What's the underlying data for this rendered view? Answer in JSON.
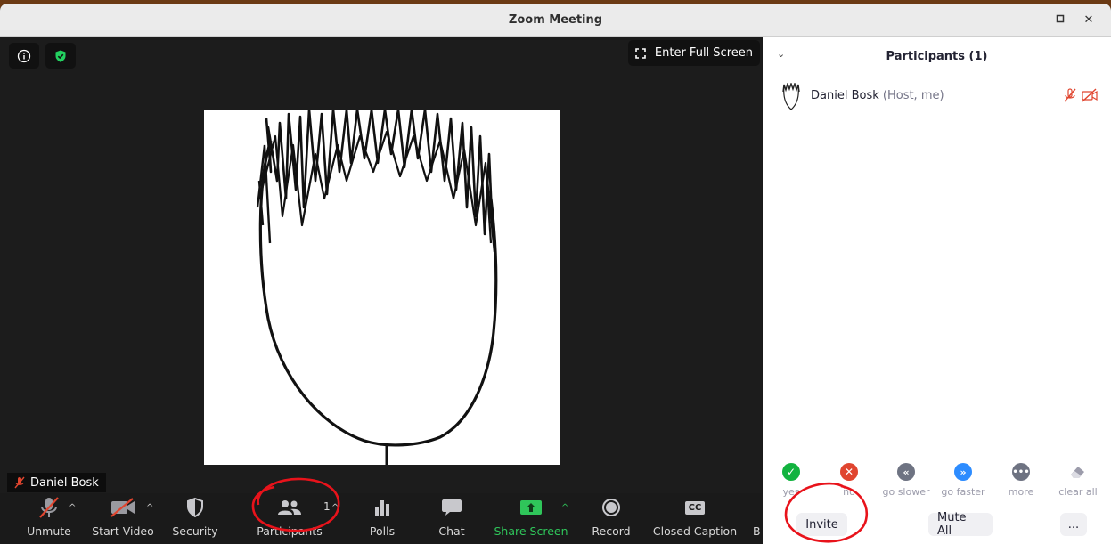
{
  "window": {
    "title": "Zoom Meeting"
  },
  "video": {
    "fullscreen_label": "Enter Full Screen",
    "name_label": "Daniel Bosk"
  },
  "toolbar": {
    "unmute": "Unmute",
    "start_video": "Start Video",
    "security": "Security",
    "participants": "Participants",
    "participants_count": "1",
    "polls": "Polls",
    "chat": "Chat",
    "share_screen": "Share Screen",
    "record": "Record",
    "closed_caption": "Closed Caption",
    "cc_badge": "CC",
    "more_cut": "B"
  },
  "panel": {
    "title": "Participants (1)",
    "participants": [
      {
        "name": "Daniel Bosk",
        "role": "(Host, me)"
      }
    ],
    "reactions": [
      {
        "label": "yes",
        "icon": "check-icon",
        "color": "#12b33f"
      },
      {
        "label": "no",
        "icon": "x-icon",
        "color": "#e0452f"
      },
      {
        "label": "go slower",
        "icon": "rewind-icon",
        "color": "#6e7382"
      },
      {
        "label": "go faster",
        "icon": "fast-forward-icon",
        "color": "#2d8cff"
      },
      {
        "label": "more",
        "icon": "ellipsis-icon",
        "color": "#6e7382"
      },
      {
        "label": "clear all",
        "icon": "eraser-icon",
        "color": "#9c9cab"
      }
    ],
    "invite": "Invite",
    "mute_all": "Mute All",
    "more": "..."
  },
  "colors": {
    "accent": "#2d8cff",
    "share_green": "#2fc55a",
    "muted_red": "#e0452f",
    "annotation_red": "#e8131b"
  }
}
